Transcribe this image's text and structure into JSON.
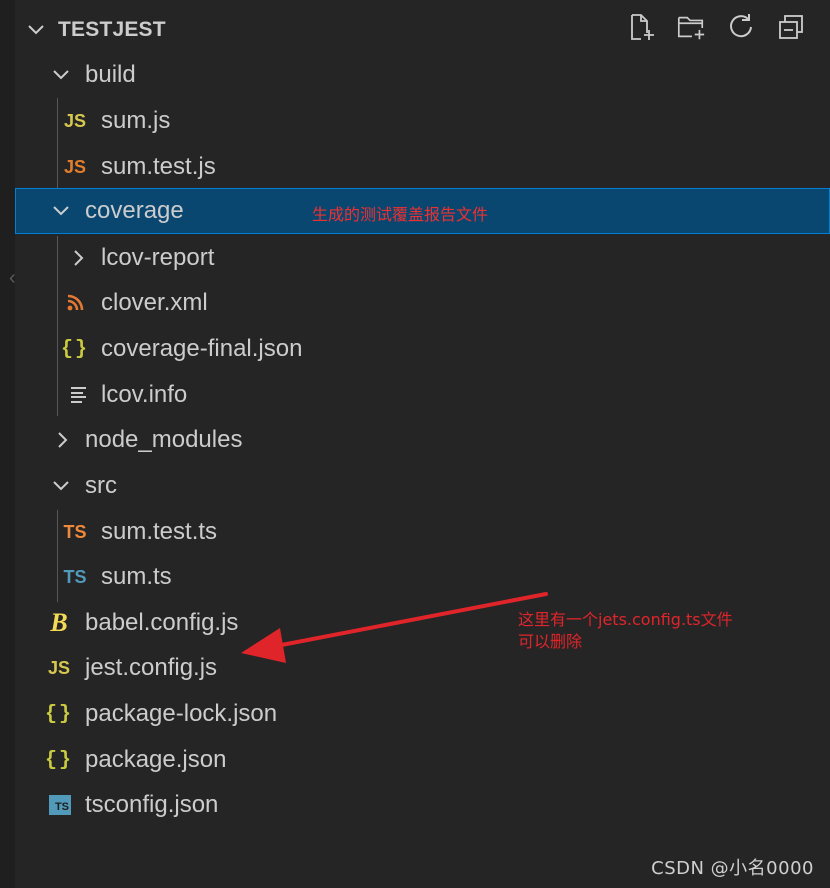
{
  "explorer": {
    "title": "TESTJEST",
    "actions": [
      {
        "name": "new-file-icon"
      },
      {
        "name": "new-folder-icon"
      },
      {
        "name": "refresh-icon"
      },
      {
        "name": "collapse-all-icon"
      }
    ],
    "colors": {
      "background": "#252526",
      "selected": "#094771",
      "selectedBorder": "#007fd4",
      "text": "#cccccc",
      "annotation": "#e0252a"
    },
    "tree": [
      {
        "label": "build",
        "type": "folder",
        "expanded": true,
        "depth": 0
      },
      {
        "label": "sum.js",
        "type": "js",
        "icon_text": "JS",
        "depth": 1
      },
      {
        "label": "sum.test.js",
        "type": "js-test",
        "icon_text": "JS",
        "depth": 1
      },
      {
        "label": "coverage",
        "type": "folder",
        "expanded": true,
        "selected": true,
        "depth": 0
      },
      {
        "label": "lcov-report",
        "type": "folder",
        "expanded": false,
        "depth": 1
      },
      {
        "label": "clover.xml",
        "type": "rss",
        "depth": 1
      },
      {
        "label": "coverage-final.json",
        "type": "json",
        "icon_text": "{}",
        "depth": 1
      },
      {
        "label": "lcov.info",
        "type": "text",
        "depth": 1
      },
      {
        "label": "node_modules",
        "type": "folder",
        "expanded": false,
        "depth": 0
      },
      {
        "label": "src",
        "type": "folder",
        "expanded": true,
        "depth": 0
      },
      {
        "label": "sum.test.ts",
        "type": "ts-test",
        "icon_text": "TS",
        "depth": 1
      },
      {
        "label": "sum.ts",
        "type": "ts",
        "icon_text": "TS",
        "depth": 1
      },
      {
        "label": "babel.config.js",
        "type": "babel",
        "icon_text": "B",
        "depth": 0
      },
      {
        "label": "jest.config.js",
        "type": "js",
        "icon_text": "JS",
        "depth": 0
      },
      {
        "label": "package-lock.json",
        "type": "json",
        "icon_text": "{}",
        "depth": 0
      },
      {
        "label": "package.json",
        "type": "json",
        "icon_text": "{}",
        "depth": 0
      },
      {
        "label": "tsconfig.json",
        "type": "tsconfig",
        "icon_text": "TS",
        "depth": 0
      }
    ]
  },
  "annotations": {
    "coverage_note": "生成的测试覆盖报告文件",
    "jets_line1": "这里有一个jets.config.ts文件",
    "jets_line2": "可以删除"
  },
  "watermark": "CSDN @小名0000"
}
